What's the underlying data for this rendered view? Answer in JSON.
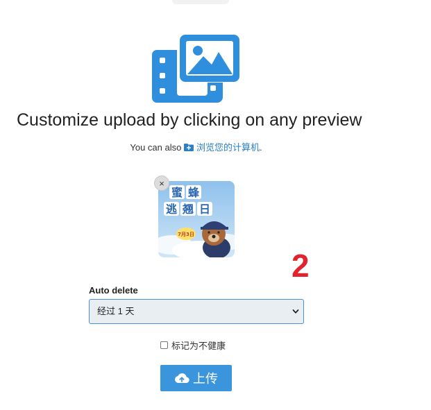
{
  "header": {
    "title": "Customize upload by clicking on any preview",
    "subtitle_prefix": "You can also",
    "browse_link": "浏览您的计算机",
    "subtitle_suffix": "."
  },
  "preview": {
    "remove_label": "×",
    "thumb_title": "蜜蜂逃翘日",
    "thumb_badge": "7月3日"
  },
  "annotation": {
    "marker": "2"
  },
  "form": {
    "auto_delete_label": "Auto delete",
    "auto_delete_value": "经过 1 天",
    "nsfw_label": "标记为不健康"
  },
  "actions": {
    "upload_label": "上传"
  },
  "colors": {
    "accent": "#3a95dd",
    "icon_blue": "#2f8fdc",
    "marker_red": "#e0232e"
  },
  "icons": {
    "hero": "media-image-icon",
    "browse": "folder-plus-icon",
    "dropdown": "chevron-down-icon",
    "upload": "cloud-upload-icon"
  }
}
